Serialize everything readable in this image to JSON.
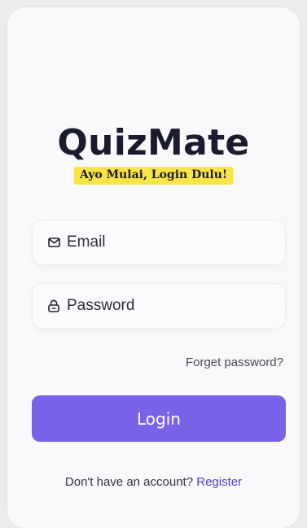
{
  "app": {
    "logo_text": "QuizMate",
    "tagline": "Ayo Mulai, Login Dulu!"
  },
  "form": {
    "email": {
      "icon": "mail-icon",
      "placeholder": "Email",
      "value": ""
    },
    "password": {
      "icon": "lock-icon",
      "placeholder": "Password",
      "value": ""
    },
    "forget_password_label": "Forget password?",
    "login_label": "Login"
  },
  "footer": {
    "prompt": "Don't have an account?",
    "register_label": "Register"
  },
  "colors": {
    "accent": "#7a62e8",
    "link": "#4b3fbd",
    "highlight": "#f9e547",
    "logo_text": "#1a1b2d",
    "background": "#f9f9fb"
  }
}
